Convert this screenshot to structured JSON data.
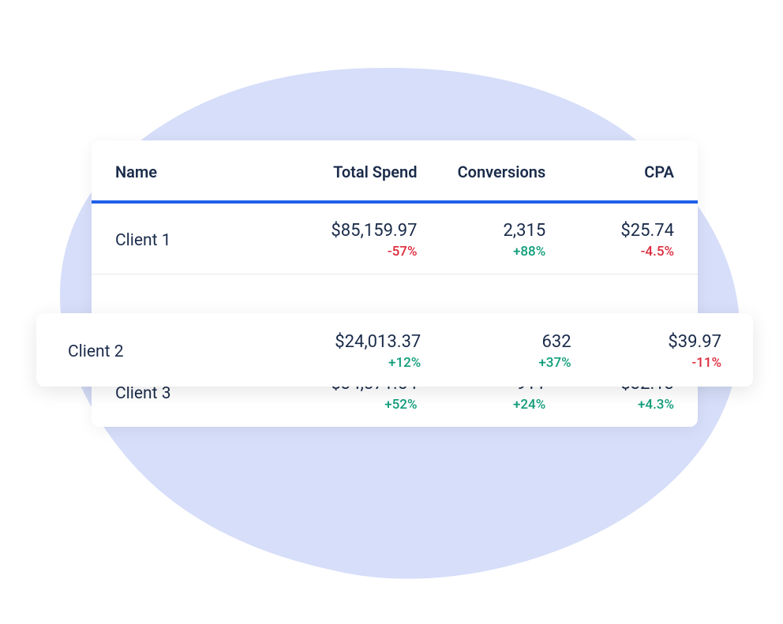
{
  "table": {
    "headers": {
      "name": "Name",
      "spend": "Total Spend",
      "conversions": "Conversions",
      "cpa": "CPA"
    },
    "rows": [
      {
        "name": "Client 1",
        "spend": {
          "value": "$85,159.97",
          "delta": "-57%",
          "delta_dir": "neg"
        },
        "conversions": {
          "value": "2,315",
          "delta": "+88%",
          "delta_dir": "pos"
        },
        "cpa": {
          "value": "$25.74",
          "delta": "-4.5%",
          "delta_dir": "neg"
        }
      },
      {
        "name": "Client 2",
        "spend": {
          "value": "$24,013.37",
          "delta": "+12%",
          "delta_dir": "pos"
        },
        "conversions": {
          "value": "632",
          "delta": "+37%",
          "delta_dir": "pos"
        },
        "cpa": {
          "value": "$39.97",
          "delta": "-11%",
          "delta_dir": "neg"
        }
      },
      {
        "name": "Client 3",
        "spend": {
          "value": "$34,871.54",
          "delta": "+52%",
          "delta_dir": "pos"
        },
        "conversions": {
          "value": "911",
          "delta": "+24%",
          "delta_dir": "pos"
        },
        "cpa": {
          "value": "$32.13",
          "delta": "+4.3%",
          "delta_dir": "pos"
        }
      }
    ]
  },
  "colors": {
    "accent": "#2060e8",
    "pos": "#0f9d7a",
    "neg": "#dc2a3b",
    "blob": "#d6def9"
  }
}
